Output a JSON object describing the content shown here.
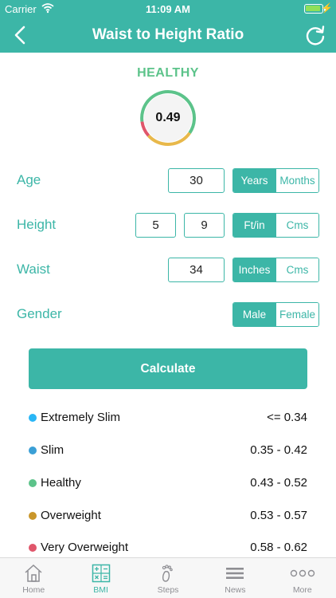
{
  "status_bar": {
    "carrier": "Carrier",
    "time": "11:09 AM"
  },
  "nav": {
    "title": "Waist to Height Ratio"
  },
  "result": {
    "category": "HEALTHY",
    "value": "0.49"
  },
  "form": {
    "age": {
      "label": "Age",
      "value": "30",
      "units": [
        "Years",
        "Months"
      ],
      "selected": "Years"
    },
    "height": {
      "label": "Height",
      "feet": "5",
      "inches": "9",
      "units": [
        "Ft/in",
        "Cms"
      ],
      "selected": "Ft/in"
    },
    "waist": {
      "label": "Waist",
      "value": "34",
      "units": [
        "Inches",
        "Cms"
      ],
      "selected": "Inches"
    },
    "gender": {
      "label": "Gender",
      "options": [
        "Male",
        "Female"
      ],
      "selected": "Male"
    }
  },
  "calculate_label": "Calculate",
  "ranges": [
    {
      "name": "Extremely Slim",
      "range": "<= 0.34",
      "color": "#29b6f6"
    },
    {
      "name": "Slim",
      "range": "0.35 - 0.42",
      "color": "#3a9fd6"
    },
    {
      "name": "Healthy",
      "range": "0.43 - 0.52",
      "color": "#5cc38a"
    },
    {
      "name": "Overweight",
      "range": "0.53 - 0.57",
      "color": "#c9962a"
    },
    {
      "name": "Very Overweight",
      "range": "0.58 - 0.62",
      "color": "#e0566b"
    }
  ],
  "tabs": [
    {
      "label": "Home",
      "icon": "home-icon"
    },
    {
      "label": "BMI",
      "icon": "calculator-icon"
    },
    {
      "label": "Steps",
      "icon": "footprint-icon"
    },
    {
      "label": "News",
      "icon": "news-icon"
    },
    {
      "label": "More",
      "icon": "more-icon"
    }
  ],
  "active_tab": "BMI",
  "colors": {
    "accent": "#3cb6a7",
    "healthy": "#5cc38a"
  }
}
